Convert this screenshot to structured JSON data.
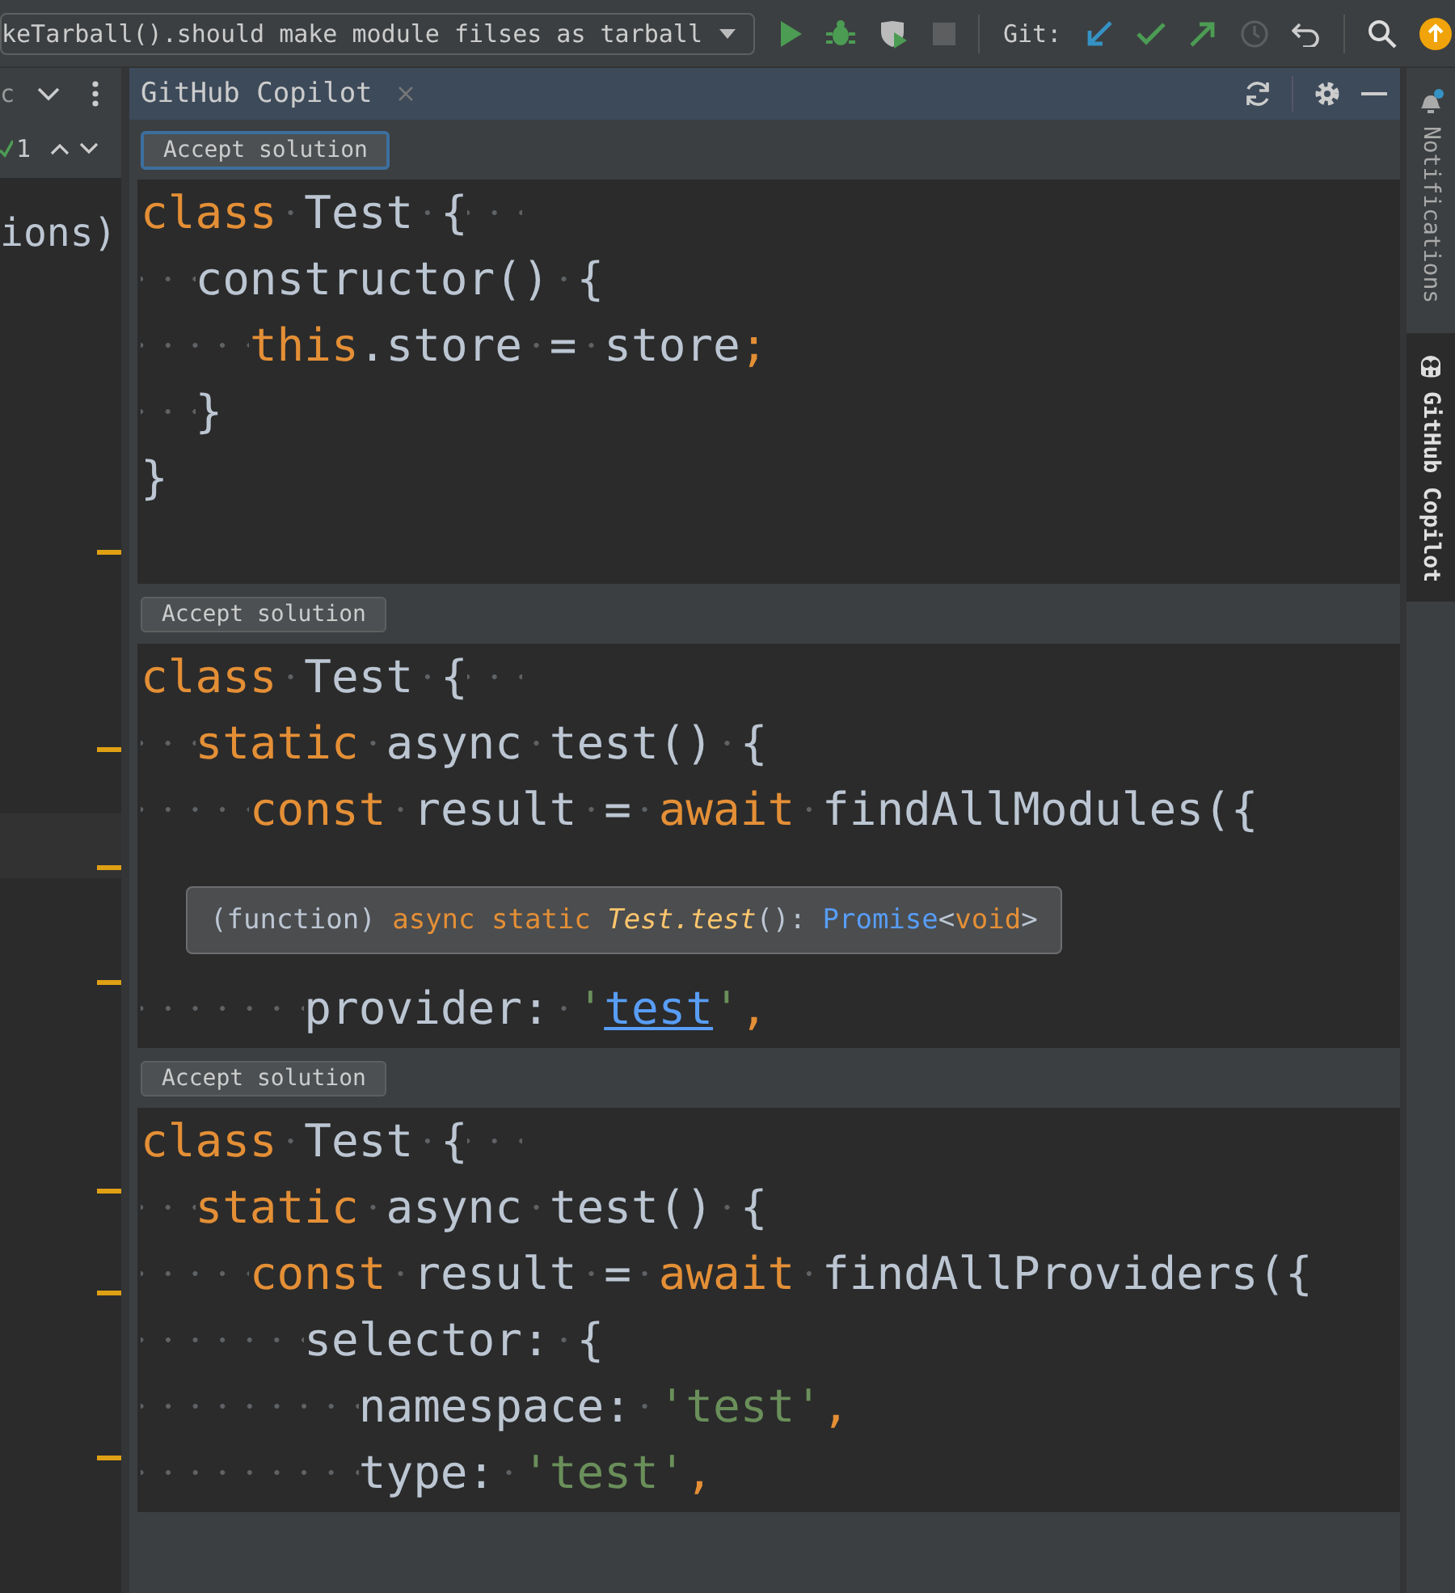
{
  "toolbar": {
    "run_config": "keTarball().should make module filses as tarball",
    "git_label": "Git:"
  },
  "left_panel": {
    "header_text": "c",
    "problem_count": "1",
    "code_fragment": "ions)"
  },
  "tool_window": {
    "title": "GitHub Copilot"
  },
  "solutions": [
    {
      "button": "Accept solution",
      "focused": true,
      "lines": [
        {
          "tokens": [
            {
              "kind": "kw",
              "text": "class"
            },
            {
              "kind": "plain",
              "text": " Test {  "
            }
          ]
        },
        {
          "tokens": [
            {
              "kind": "plain",
              "text": "  constructor() {"
            }
          ]
        },
        {
          "tokens": [
            {
              "kind": "kw",
              "text": "    this"
            },
            {
              "kind": "plain",
              "text": ".store = store"
            },
            {
              "kind": "kw",
              "text": ";"
            }
          ]
        },
        {
          "tokens": [
            {
              "kind": "plain",
              "text": "  }"
            }
          ]
        },
        {
          "tokens": [
            {
              "kind": "plain",
              "text": "}"
            }
          ]
        }
      ]
    },
    {
      "button": "Accept solution",
      "focused": false,
      "lines": [
        {
          "tokens": [
            {
              "kind": "kw",
              "text": "class"
            },
            {
              "kind": "plain",
              "text": " Test {  "
            }
          ]
        },
        {
          "tokens": [
            {
              "kind": "kw",
              "text": "  static"
            },
            {
              "kind": "plain",
              "text": " async test() {"
            }
          ]
        },
        {
          "tokens": [
            {
              "kind": "kw",
              "text": "    const"
            },
            {
              "kind": "plain",
              "text": " result = "
            },
            {
              "kind": "kw",
              "text": "await"
            },
            {
              "kind": "plain",
              "text": " findAllModules({"
            }
          ]
        },
        {
          "tooltip": [
            {
              "kind": "plain",
              "text": "(function) "
            },
            {
              "kind": "kw",
              "text": "async static "
            },
            {
              "kind": "fn",
              "text": "Test.test"
            },
            {
              "kind": "plain",
              "text": "(): "
            },
            {
              "kind": "type",
              "text": "Promise"
            },
            {
              "kind": "plain",
              "text": "<"
            },
            {
              "kind": "kw",
              "text": "void"
            },
            {
              "kind": "plain",
              "text": ">"
            }
          ]
        },
        {
          "tokens": [
            {
              "kind": "plain",
              "text": "      provider: "
            },
            {
              "kind": "str",
              "text": "'"
            },
            {
              "kind": "link",
              "text": "test"
            },
            {
              "kind": "str",
              "text": "'"
            },
            {
              "kind": "kw",
              "text": ","
            }
          ]
        }
      ]
    },
    {
      "button": "Accept solution",
      "focused": false,
      "lines": [
        {
          "tokens": [
            {
              "kind": "kw",
              "text": "class"
            },
            {
              "kind": "plain",
              "text": " Test {  "
            }
          ]
        },
        {
          "tokens": [
            {
              "kind": "kw",
              "text": "  static"
            },
            {
              "kind": "plain",
              "text": " async test() {"
            }
          ]
        },
        {
          "tokens": [
            {
              "kind": "kw",
              "text": "    const"
            },
            {
              "kind": "plain",
              "text": " result = "
            },
            {
              "kind": "kw",
              "text": "await"
            },
            {
              "kind": "plain",
              "text": " findAllProviders({"
            }
          ]
        },
        {
          "tokens": [
            {
              "kind": "plain",
              "text": "      selector: {"
            }
          ]
        },
        {
          "tokens": [
            {
              "kind": "plain",
              "text": "        namespace: "
            },
            {
              "kind": "str",
              "text": "'test'"
            },
            {
              "kind": "kw",
              "text": ","
            }
          ]
        },
        {
          "tokens": [
            {
              "kind": "plain",
              "text": "        type: "
            },
            {
              "kind": "str",
              "text": "'test'"
            },
            {
              "kind": "kw",
              "text": ","
            }
          ]
        }
      ]
    }
  ],
  "side_bar": [
    {
      "label": "Notifications",
      "kind": "notifications",
      "selected": false
    },
    {
      "label": "GitHub Copilot",
      "kind": "copilot",
      "selected": true
    }
  ]
}
